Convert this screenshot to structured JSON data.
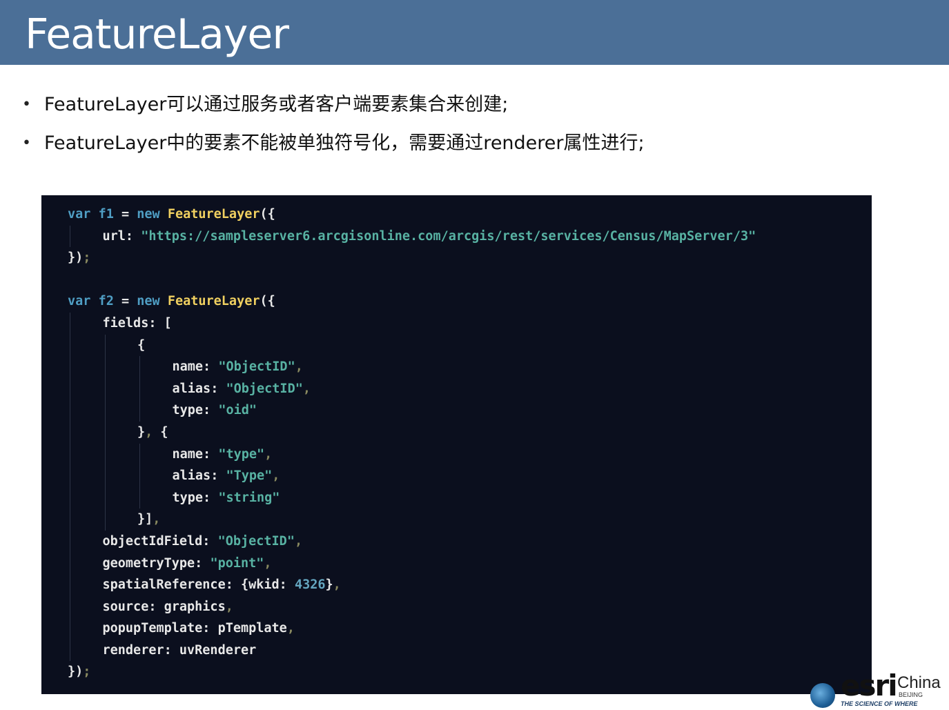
{
  "slide": {
    "title": "FeatureLayer",
    "bullets": [
      "FeatureLayer可以通过服务或者客户端要素集合来创建;",
      "FeatureLayer中的要素不能被单独符号化，需要通过renderer属性进行;"
    ],
    "bullet_marker": "•"
  },
  "code": {
    "lines": [
      {
        "indent": 0,
        "tokens": [
          [
            "kw",
            "var"
          ],
          [
            "plain",
            " "
          ],
          [
            "kw",
            "f1"
          ],
          [
            "plain",
            " = "
          ],
          [
            "kw",
            "new"
          ],
          [
            "plain",
            " "
          ],
          [
            "fn",
            "FeatureLayer"
          ],
          [
            "plain",
            "({"
          ]
        ]
      },
      {
        "indent": 1,
        "tokens": [
          [
            "plain",
            "url: "
          ],
          [
            "str",
            "\"https://sampleserver6.arcgisonline.com/arcgis/rest/services/Census/MapServer/3\""
          ]
        ]
      },
      {
        "indent": 0,
        "tokens": [
          [
            "plain",
            "})"
          ],
          [
            "punc",
            ";"
          ]
        ]
      },
      {
        "indent": 0,
        "tokens": []
      },
      {
        "indent": 0,
        "tokens": [
          [
            "kw",
            "var"
          ],
          [
            "plain",
            " "
          ],
          [
            "kw",
            "f2"
          ],
          [
            "plain",
            " = "
          ],
          [
            "kw",
            "new"
          ],
          [
            "plain",
            " "
          ],
          [
            "fn",
            "FeatureLayer"
          ],
          [
            "plain",
            "({"
          ]
        ]
      },
      {
        "indent": 1,
        "tokens": [
          [
            "plain",
            "fields: ["
          ]
        ]
      },
      {
        "indent": 2,
        "tokens": [
          [
            "plain",
            "{"
          ]
        ]
      },
      {
        "indent": 3,
        "tokens": [
          [
            "plain",
            "name: "
          ],
          [
            "str",
            "\"ObjectID\""
          ],
          [
            "punc",
            ","
          ]
        ]
      },
      {
        "indent": 3,
        "tokens": [
          [
            "plain",
            "alias: "
          ],
          [
            "str",
            "\"ObjectID\""
          ],
          [
            "punc",
            ","
          ]
        ]
      },
      {
        "indent": 3,
        "tokens": [
          [
            "plain",
            "type: "
          ],
          [
            "str",
            "\"oid\""
          ]
        ]
      },
      {
        "indent": 2,
        "tokens": [
          [
            "plain",
            "}"
          ],
          [
            "punc",
            ","
          ],
          [
            "plain",
            " {"
          ]
        ]
      },
      {
        "indent": 3,
        "tokens": [
          [
            "plain",
            "name: "
          ],
          [
            "str",
            "\"type\""
          ],
          [
            "punc",
            ","
          ]
        ]
      },
      {
        "indent": 3,
        "tokens": [
          [
            "plain",
            "alias: "
          ],
          [
            "str",
            "\"Type\""
          ],
          [
            "punc",
            ","
          ]
        ]
      },
      {
        "indent": 3,
        "tokens": [
          [
            "plain",
            "type: "
          ],
          [
            "str",
            "\"string\""
          ]
        ]
      },
      {
        "indent": 2,
        "tokens": [
          [
            "plain",
            "}]"
          ],
          [
            "punc",
            ","
          ]
        ]
      },
      {
        "indent": 1,
        "tokens": [
          [
            "plain",
            "objectIdField: "
          ],
          [
            "str",
            "\"ObjectID\""
          ],
          [
            "punc",
            ","
          ]
        ]
      },
      {
        "indent": 1,
        "tokens": [
          [
            "plain",
            "geometryType: "
          ],
          [
            "str",
            "\"point\""
          ],
          [
            "punc",
            ","
          ]
        ]
      },
      {
        "indent": 1,
        "tokens": [
          [
            "plain",
            "spatialReference: {wkid: "
          ],
          [
            "num",
            "4326"
          ],
          [
            "plain",
            "}"
          ],
          [
            "punc",
            ","
          ]
        ]
      },
      {
        "indent": 1,
        "tokens": [
          [
            "plain",
            "source: graphics"
          ],
          [
            "punc",
            ","
          ]
        ]
      },
      {
        "indent": 1,
        "tokens": [
          [
            "plain",
            "popupTemplate: pTemplate"
          ],
          [
            "punc",
            ","
          ]
        ]
      },
      {
        "indent": 1,
        "tokens": [
          [
            "plain",
            "renderer: uvRenderer"
          ]
        ]
      },
      {
        "indent": 0,
        "tokens": [
          [
            "plain",
            "})"
          ],
          [
            "punc",
            ";"
          ]
        ]
      }
    ]
  },
  "logo": {
    "wordmark": "esri",
    "region": "China",
    "city": "BEIJING",
    "tagline": "THE SCIENCE OF WHERE"
  },
  "colors": {
    "title_bar": "#4b6f97",
    "code_background": "#0b0f1e",
    "keyword": "#4f9ec4",
    "function": "#f0d060",
    "string": "#58b2a3"
  }
}
